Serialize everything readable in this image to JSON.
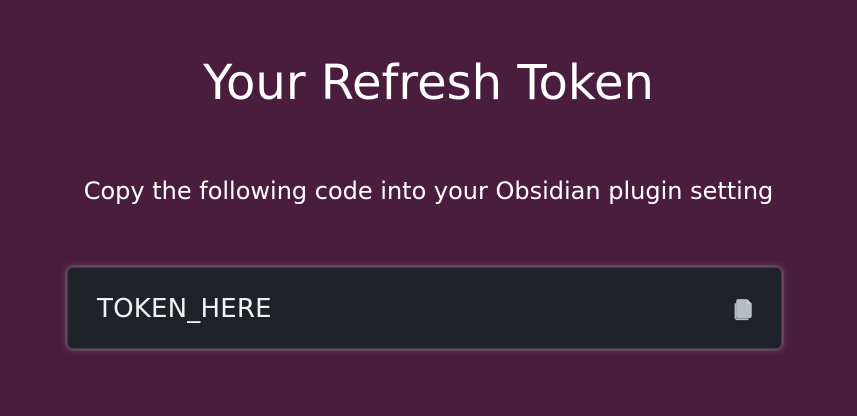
{
  "page": {
    "title": "Your Refresh Token",
    "subtitle": "Copy the following code into your Obsidian plugin setting"
  },
  "token_field": {
    "value": "TOKEN_HERE",
    "copy_icon": "copy-icon"
  },
  "colors": {
    "background": "#4a1d3f",
    "field_background": "#1f2329",
    "text": "#ffffff",
    "icon": "#b7bcc3"
  }
}
